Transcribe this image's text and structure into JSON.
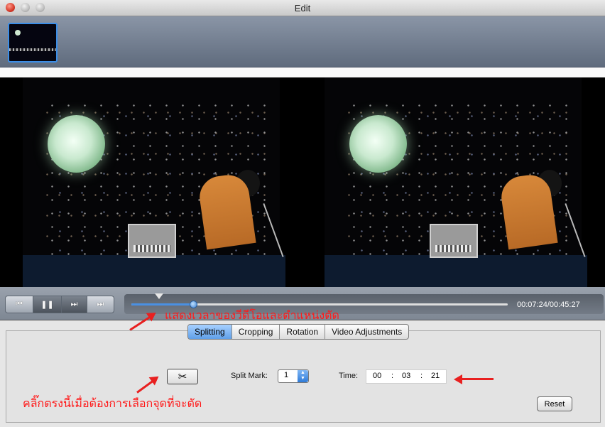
{
  "window": {
    "title": "Edit"
  },
  "transport": {
    "buttons": [
      "prev-icon",
      "pause-icon",
      "fast-forward-icon",
      "next-icon"
    ],
    "glyphs": {
      "prev": "⏮",
      "pause": "❚❚",
      "ffwd": "⏭",
      "next": "⏭"
    },
    "timecode": "00:07:24/00:45:27",
    "progress_fraction": 0.165,
    "split_mark_fraction": 0.074
  },
  "annotations": {
    "seek": "แสดงเวลาของวีดีโอและตำแหน่งตัด",
    "scissor": "คลิ๊กตรงนี้เมื่อต้องการเลือกจุดที่จะตัด"
  },
  "tabs": [
    {
      "label": "Splitting",
      "active": true
    },
    {
      "label": "Cropping",
      "active": false
    },
    {
      "label": "Rotation",
      "active": false
    },
    {
      "label": "Video Adjustments",
      "active": false
    }
  ],
  "splitting": {
    "scissor_glyph": "✂",
    "split_mark_label": "Split Mark:",
    "split_mark_value": "1",
    "time_label": "Time:",
    "time": {
      "hh": "00",
      "mm": "03",
      "ss": "21",
      "sep": ":"
    },
    "reset_label": "Reset"
  },
  "colors": {
    "accent": "#4a90e2",
    "annotation": "#ff1a1a"
  }
}
